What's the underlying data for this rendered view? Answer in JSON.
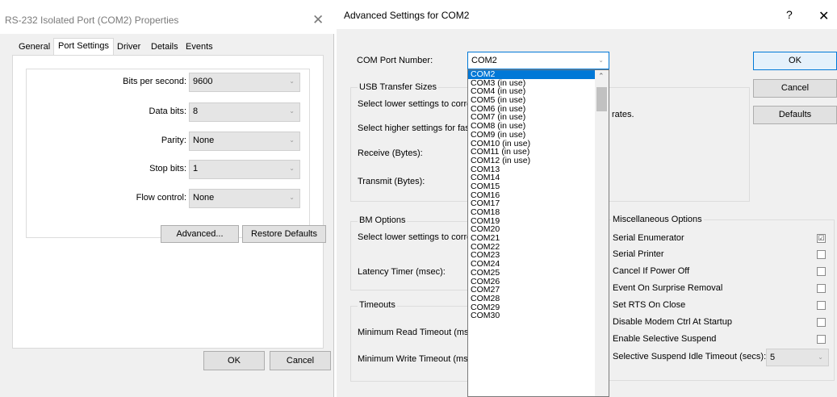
{
  "w1": {
    "title": "RS-232 Isolated Port (COM2) Properties",
    "close": "✕",
    "tabs": [
      {
        "label": "General"
      },
      {
        "label": "Port Settings"
      },
      {
        "label": "Driver"
      },
      {
        "label": "Details"
      },
      {
        "label": "Events"
      }
    ],
    "fields": [
      {
        "label": "Bits per second:",
        "value": "9600"
      },
      {
        "label": "Data bits:",
        "value": "8"
      },
      {
        "label": "Parity:",
        "value": "None"
      },
      {
        "label": "Stop bits:",
        "value": "1"
      },
      {
        "label": "Flow control:",
        "value": "None"
      }
    ],
    "advanced": "Advanced...",
    "restore": "Restore Defaults",
    "ok": "OK",
    "cancel": "Cancel"
  },
  "w2": {
    "title": "Advanced Settings for COM2",
    "help": "?",
    "close": "✕",
    "com_label": "COM Port Number:",
    "com_value": "COM2",
    "ok": "OK",
    "cancel": "Cancel",
    "defaults": "Defaults",
    "usb": {
      "title": "USB Transfer Sizes",
      "lower": "Select lower settings to corre",
      "rates": "rates.",
      "higher": "Select higher settings for fast",
      "receive": "Receive (Bytes):",
      "transmit": "Transmit (Bytes):"
    },
    "bm": {
      "title": "BM Options",
      "lower": "Select lower settings to corre",
      "latency": "Latency Timer (msec):"
    },
    "timeouts": {
      "title": "Timeouts",
      "read": "Minimum Read Timeout (mse",
      "write": "Minimum Write Timeout (mse"
    },
    "misc": {
      "title": "Miscellaneous Options",
      "items": [
        {
          "label": "Serial Enumerator",
          "checked": "☑"
        },
        {
          "label": "Serial Printer",
          "checked": ""
        },
        {
          "label": "Cancel If Power Off",
          "checked": ""
        },
        {
          "label": "Event On Surprise Removal",
          "checked": ""
        },
        {
          "label": "Set RTS On Close",
          "checked": ""
        },
        {
          "label": "Disable Modem Ctrl At Startup",
          "checked": ""
        },
        {
          "label": "Enable Selective Suspend",
          "checked": ""
        }
      ],
      "idle_label": "Selective Suspend Idle Timeout (secs):",
      "idle_value": "5"
    },
    "dropdown": [
      "COM2",
      "COM3 (in use)",
      "COM4 (in use)",
      "COM5 (in use)",
      "COM6 (in use)",
      "COM7 (in use)",
      "COM8 (in use)",
      "COM9 (in use)",
      "COM10 (in use)",
      "COM11 (in use)",
      "COM12 (in use)",
      "COM13",
      "COM14",
      "COM15",
      "COM16",
      "COM17",
      "COM18",
      "COM19",
      "COM20",
      "COM21",
      "COM22",
      "COM23",
      "COM24",
      "COM25",
      "COM26",
      "COM27",
      "COM28",
      "COM29",
      "COM30"
    ]
  }
}
